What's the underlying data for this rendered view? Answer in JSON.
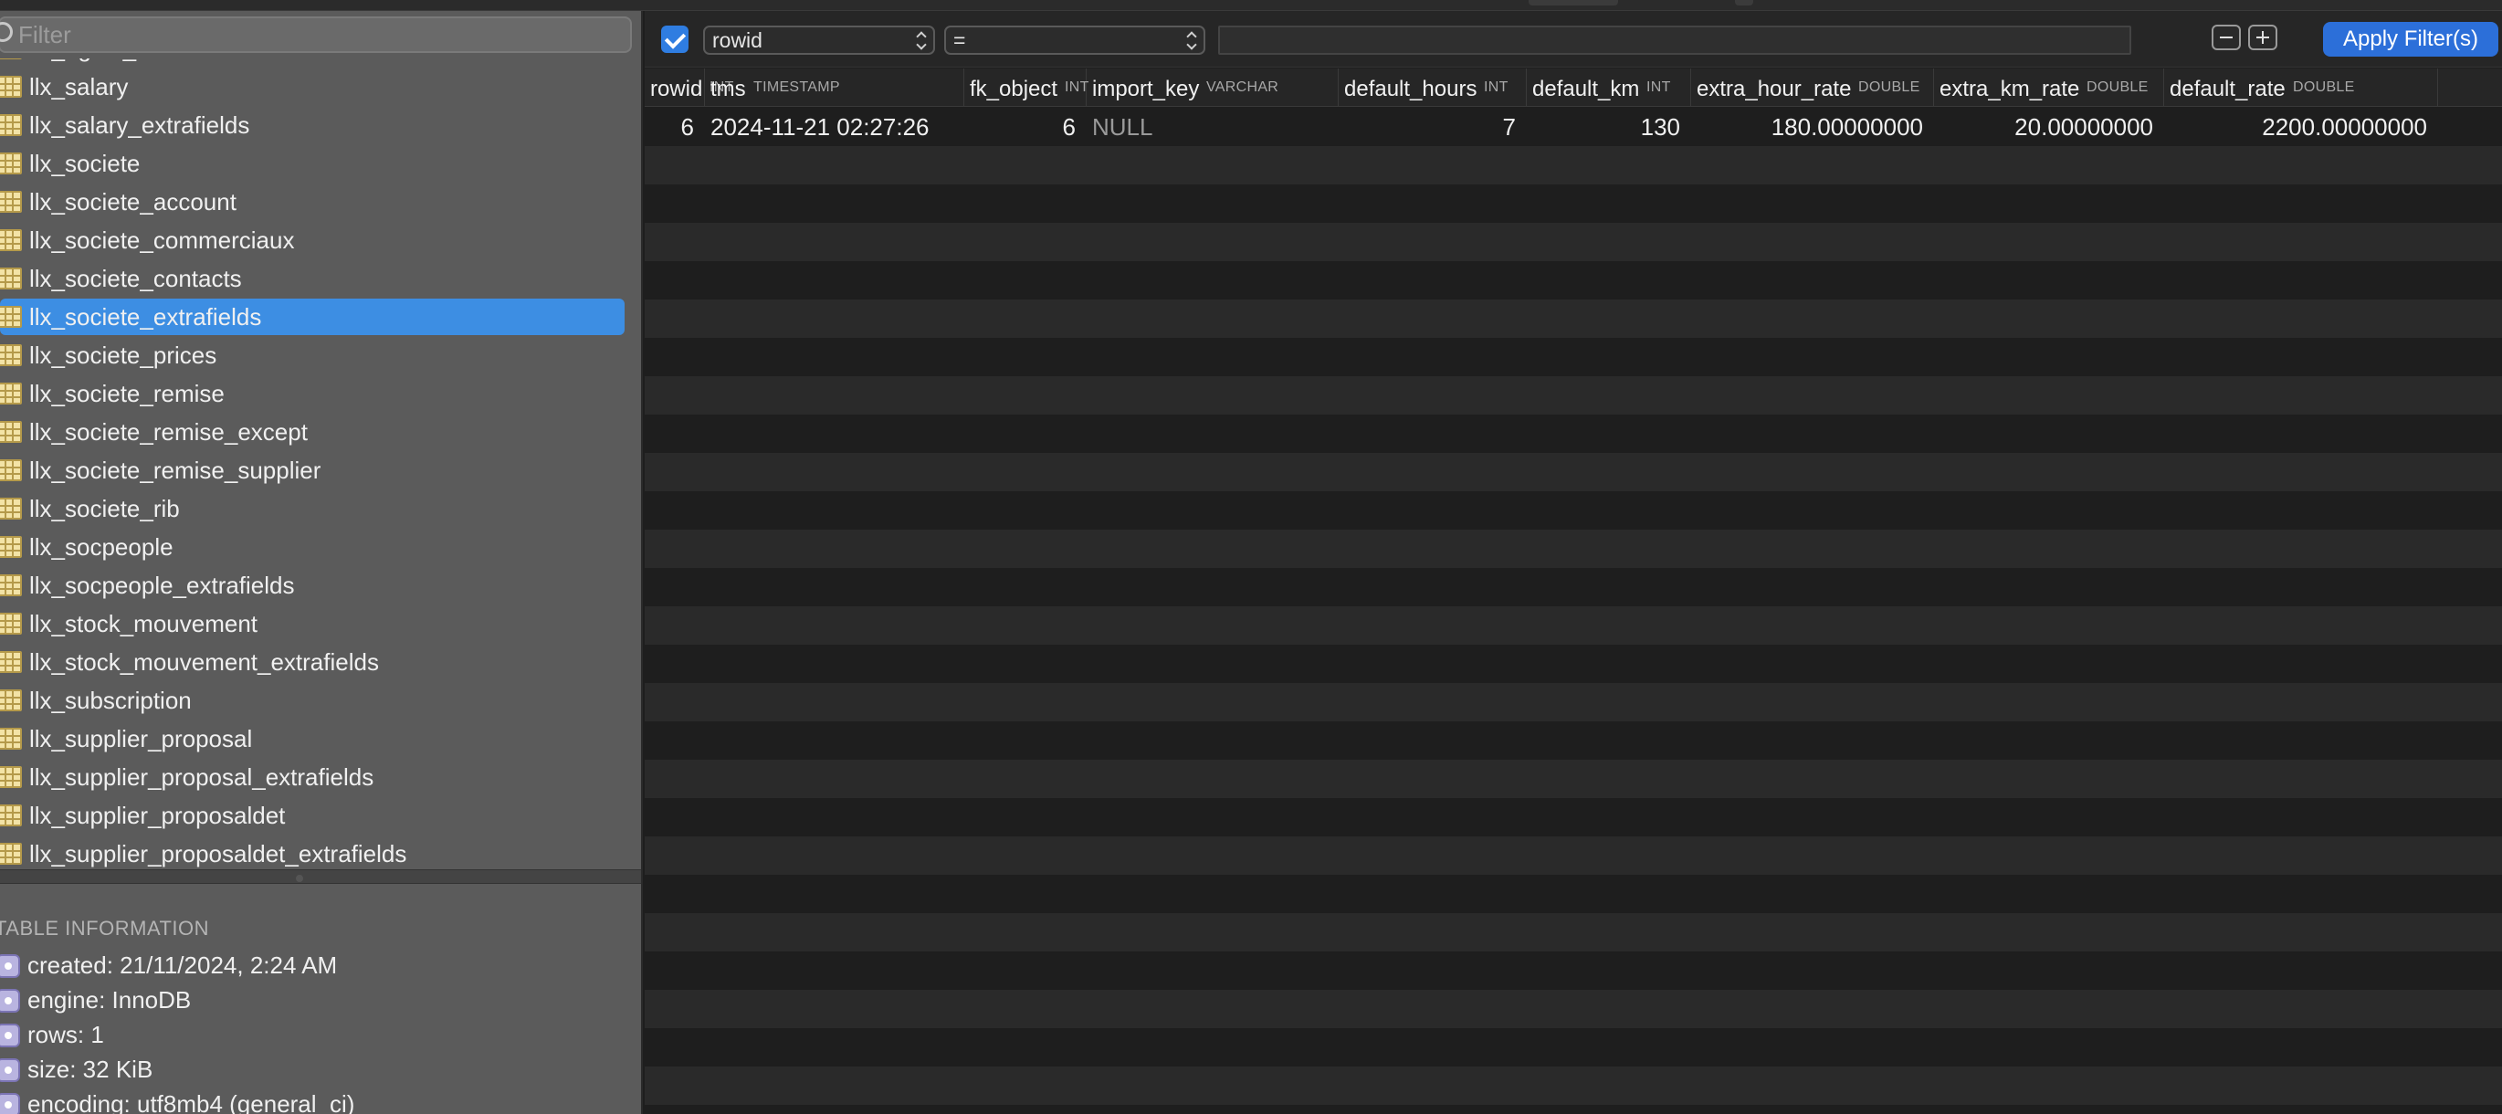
{
  "sidebar": {
    "filter_placeholder": "Filter",
    "tables": [
      "llx_rights_def",
      "llx_salary",
      "llx_salary_extrafields",
      "llx_societe",
      "llx_societe_account",
      "llx_societe_commerciaux",
      "llx_societe_contacts",
      "llx_societe_extrafields",
      "llx_societe_prices",
      "llx_societe_remise",
      "llx_societe_remise_except",
      "llx_societe_remise_supplier",
      "llx_societe_rib",
      "llx_socpeople",
      "llx_socpeople_extrafields",
      "llx_stock_mouvement",
      "llx_stock_mouvement_extrafields",
      "llx_subscription",
      "llx_supplier_proposal",
      "llx_supplier_proposal_extrafields",
      "llx_supplier_proposaldet",
      "llx_supplier_proposaldet_extrafields"
    ],
    "selected_table": "llx_societe_extrafields",
    "info_title": "TABLE INFORMATION",
    "info": [
      "created: 21/11/2024, 2:24 AM",
      "engine: InnoDB",
      "rows: 1",
      "size: 32 KiB",
      "encoding: utf8mb4 (general_ci)"
    ]
  },
  "filter": {
    "enabled": true,
    "field": "rowid",
    "operator": "=",
    "value": "",
    "apply_label": "Apply Filter(s)"
  },
  "columns": [
    {
      "name": "rowid",
      "type": "INT"
    },
    {
      "name": "tms",
      "type": "TIMESTAMP"
    },
    {
      "name": "fk_object",
      "type": "INT"
    },
    {
      "name": "import_key",
      "type": "VARCHAR"
    },
    {
      "name": "default_hours",
      "type": "INT"
    },
    {
      "name": "default_km",
      "type": "INT"
    },
    {
      "name": "extra_hour_rate",
      "type": "DOUBLE"
    },
    {
      "name": "extra_km_rate",
      "type": "DOUBLE"
    },
    {
      "name": "default_rate",
      "type": "DOUBLE"
    }
  ],
  "rows": [
    [
      "6",
      "2024-11-21 02:27:26",
      "6",
      "NULL",
      "7",
      "130",
      "180.00000000",
      "20.00000000",
      "2200.00000000"
    ]
  ]
}
